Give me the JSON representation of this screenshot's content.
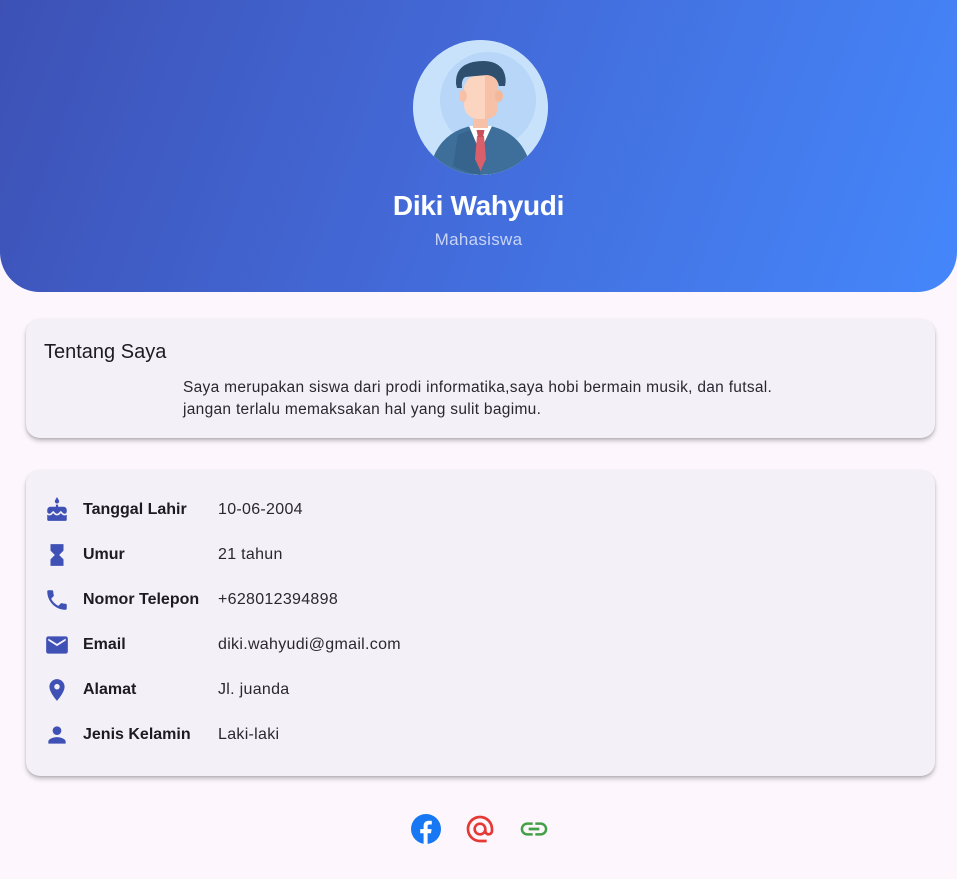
{
  "profile": {
    "name": "Diki Wahyudi",
    "role": "Mahasiswa",
    "avatar_icon": "businessman-avatar-icon"
  },
  "about": {
    "title": "Tentang Saya",
    "text": "Saya merupakan siswa dari prodi informatika,saya hobi bermain musik, dan futsal.\njangan terlalu memaksakan hal yang sulit bagimu."
  },
  "info": {
    "rows": [
      {
        "icon": "cake-icon",
        "label": "Tanggal Lahir",
        "value": "10-06-2004"
      },
      {
        "icon": "hourglass-icon",
        "label": "Umur",
        "value": "21 tahun"
      },
      {
        "icon": "phone-icon",
        "label": "Nomor Telepon",
        "value": "+628012394898"
      },
      {
        "icon": "email-icon",
        "label": "Email",
        "value": "diki.wahyudi@gmail.com"
      },
      {
        "icon": "location-pin-icon",
        "label": "Alamat",
        "value": "Jl. juanda"
      },
      {
        "icon": "person-icon",
        "label": "Jenis Kelamin",
        "value": "Laki-laki"
      }
    ]
  },
  "social": [
    {
      "icon": "facebook-icon",
      "color": "#1877f2"
    },
    {
      "icon": "at-sign-icon",
      "color": "#e53935"
    },
    {
      "icon": "link-icon",
      "color": "#43a047"
    }
  ],
  "colors": {
    "header_start": "#3d51b5",
    "header_end": "#4487fb",
    "accent_icon": "#3f51b5",
    "background": "#fdf7fd",
    "card": "#f4f0f7"
  }
}
